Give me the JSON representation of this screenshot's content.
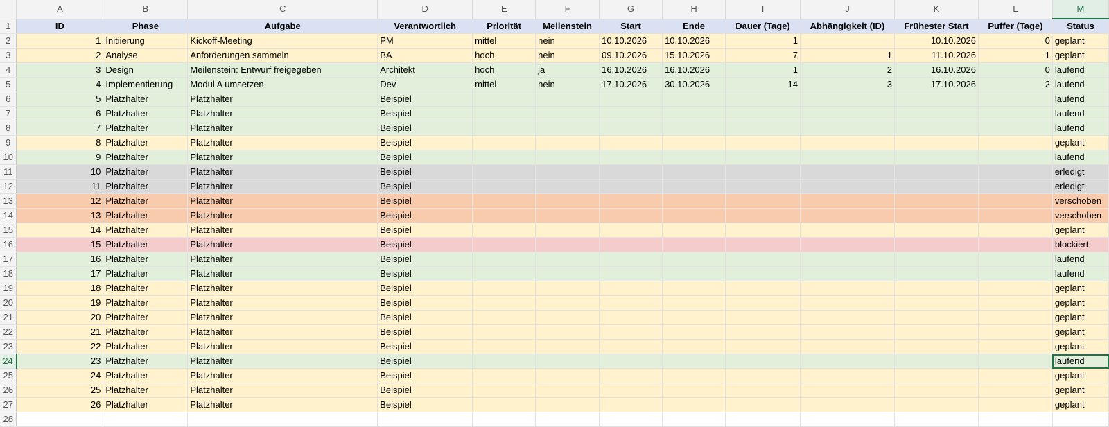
{
  "columns": [
    "A",
    "B",
    "C",
    "D",
    "E",
    "F",
    "G",
    "H",
    "I",
    "J",
    "K",
    "L",
    "M"
  ],
  "active_column": "M",
  "active_row": 24,
  "headers": [
    "ID",
    "Phase",
    "Aufgabe",
    "Verantwortlich",
    "Priorität",
    "Meilenstein",
    "Start",
    "Ende",
    "Dauer (Tage)",
    "Abhängigkeit (ID)",
    "Frühester Start",
    "Puffer (Tage)",
    "Status"
  ],
  "rows": [
    {
      "id": "1",
      "phase": "Initiierung",
      "aufgabe": "Kickoff-Meeting",
      "verantwortlich": "PM",
      "prioritaet": "mittel",
      "meilenstein": "nein",
      "start": "10.10.2026",
      "ende": "10.10.2026",
      "dauer": "1",
      "abh": "",
      "frueh": "10.10.2026",
      "puffer": "0",
      "status": "geplant"
    },
    {
      "id": "2",
      "phase": "Analyse",
      "aufgabe": "Anforderungen sammeln",
      "verantwortlich": "BA",
      "prioritaet": "hoch",
      "meilenstein": "nein",
      "start": "09.10.2026",
      "ende": "15.10.2026",
      "dauer": "7",
      "abh": "1",
      "frueh": "11.10.2026",
      "puffer": "1",
      "status": "geplant"
    },
    {
      "id": "3",
      "phase": "Design",
      "aufgabe": "Meilenstein: Entwurf freigegeben",
      "verantwortlich": "Architekt",
      "prioritaet": "hoch",
      "meilenstein": "ja",
      "start": "16.10.2026",
      "ende": "16.10.2026",
      "dauer": "1",
      "abh": "2",
      "frueh": "16.10.2026",
      "puffer": "0",
      "status": "laufend"
    },
    {
      "id": "4",
      "phase": "Implementierung",
      "aufgabe": "Modul A umsetzen",
      "verantwortlich": "Dev",
      "prioritaet": "mittel",
      "meilenstein": "nein",
      "start": "17.10.2026",
      "ende": "30.10.2026",
      "dauer": "14",
      "abh": "3",
      "frueh": "17.10.2026",
      "puffer": "2",
      "status": "laufend"
    },
    {
      "id": "5",
      "phase": "Platzhalter",
      "aufgabe": "Platzhalter",
      "verantwortlich": "Beispiel",
      "status": "laufend"
    },
    {
      "id": "6",
      "phase": "Platzhalter",
      "aufgabe": "Platzhalter",
      "verantwortlich": "Beispiel",
      "status": "laufend"
    },
    {
      "id": "7",
      "phase": "Platzhalter",
      "aufgabe": "Platzhalter",
      "verantwortlich": "Beispiel",
      "status": "laufend"
    },
    {
      "id": "8",
      "phase": "Platzhalter",
      "aufgabe": "Platzhalter",
      "verantwortlich": "Beispiel",
      "status": "geplant"
    },
    {
      "id": "9",
      "phase": "Platzhalter",
      "aufgabe": "Platzhalter",
      "verantwortlich": "Beispiel",
      "status": "laufend"
    },
    {
      "id": "10",
      "phase": "Platzhalter",
      "aufgabe": "Platzhalter",
      "verantwortlich": "Beispiel",
      "status": "erledigt"
    },
    {
      "id": "11",
      "phase": "Platzhalter",
      "aufgabe": "Platzhalter",
      "verantwortlich": "Beispiel",
      "status": "erledigt"
    },
    {
      "id": "12",
      "phase": "Platzhalter",
      "aufgabe": "Platzhalter",
      "verantwortlich": "Beispiel",
      "status": "verschoben"
    },
    {
      "id": "13",
      "phase": "Platzhalter",
      "aufgabe": "Platzhalter",
      "verantwortlich": "Beispiel",
      "status": "verschoben"
    },
    {
      "id": "14",
      "phase": "Platzhalter",
      "aufgabe": "Platzhalter",
      "verantwortlich": "Beispiel",
      "status": "geplant"
    },
    {
      "id": "15",
      "phase": "Platzhalter",
      "aufgabe": "Platzhalter",
      "verantwortlich": "Beispiel",
      "status": "blockiert"
    },
    {
      "id": "16",
      "phase": "Platzhalter",
      "aufgabe": "Platzhalter",
      "verantwortlich": "Beispiel",
      "status": "laufend"
    },
    {
      "id": "17",
      "phase": "Platzhalter",
      "aufgabe": "Platzhalter",
      "verantwortlich": "Beispiel",
      "status": "laufend"
    },
    {
      "id": "18",
      "phase": "Platzhalter",
      "aufgabe": "Platzhalter",
      "verantwortlich": "Beispiel",
      "status": "geplant"
    },
    {
      "id": "19",
      "phase": "Platzhalter",
      "aufgabe": "Platzhalter",
      "verantwortlich": "Beispiel",
      "status": "geplant"
    },
    {
      "id": "20",
      "phase": "Platzhalter",
      "aufgabe": "Platzhalter",
      "verantwortlich": "Beispiel",
      "status": "geplant"
    },
    {
      "id": "21",
      "phase": "Platzhalter",
      "aufgabe": "Platzhalter",
      "verantwortlich": "Beispiel",
      "status": "geplant"
    },
    {
      "id": "22",
      "phase": "Platzhalter",
      "aufgabe": "Platzhalter",
      "verantwortlich": "Beispiel",
      "status": "geplant"
    },
    {
      "id": "23",
      "phase": "Platzhalter",
      "aufgabe": "Platzhalter",
      "verantwortlich": "Beispiel",
      "status": "laufend"
    },
    {
      "id": "24",
      "phase": "Platzhalter",
      "aufgabe": "Platzhalter",
      "verantwortlich": "Beispiel",
      "status": "geplant"
    },
    {
      "id": "25",
      "phase": "Platzhalter",
      "aufgabe": "Platzhalter",
      "verantwortlich": "Beispiel",
      "status": "geplant"
    },
    {
      "id": "26",
      "phase": "Platzhalter",
      "aufgabe": "Platzhalter",
      "verantwortlich": "Beispiel",
      "status": "geplant"
    }
  ],
  "empty_row_numbers": [
    28
  ],
  "status_colors": {
    "geplant": "#fff2cc",
    "laufend": "#e2efda",
    "erledigt": "#d9d9d9",
    "verschoben": "#f8cbad",
    "blockiert": "#f4cccc",
    "header": "#d9e1f2",
    "selection": "#217346"
  }
}
